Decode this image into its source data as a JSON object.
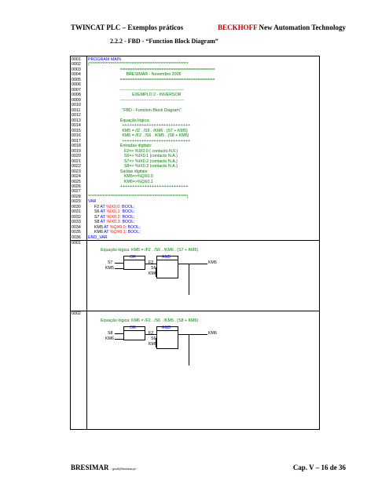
{
  "header": {
    "left": "TWINCAT PLC – Exemplos práticos",
    "brand": "BECKHOFF",
    "right_rest": "New Automation Technology"
  },
  "section": "2.2.2 - FBD - “Function Block Diagram”",
  "code_lines": [
    {
      "n": "0001",
      "t": "PROGRAM MAIN",
      "c": "blue",
      "i": 0
    },
    {
      "n": "0002",
      "t": "(*************************************************************",
      "c": "green",
      "i": 0
    },
    {
      "n": "0003",
      "t": "=======================================",
      "c": "green",
      "i": 16
    },
    {
      "n": "0004",
      "t": "BRESIMAR - Novembro 2005",
      "c": "green",
      "i": 19
    },
    {
      "n": "0005",
      "t": "=======================================",
      "c": "green",
      "i": 16
    },
    {
      "n": "0006",
      "t": "",
      "c": "green",
      "i": 0
    },
    {
      "n": "0007",
      "t": "----------------------------------------------",
      "c": "green",
      "i": 16
    },
    {
      "n": "0008",
      "t": "EXEMPLO 2 - INVERSOR",
      "c": "green",
      "i": 22
    },
    {
      "n": "0009",
      "t": "----------------------------------------------",
      "c": "green",
      "i": 16
    },
    {
      "n": "0010",
      "t": "",
      "c": "green",
      "i": 0
    },
    {
      "n": "0011",
      "t": "\"FBD - Function Block Diagram\"",
      "c": "green",
      "i": 17
    },
    {
      "n": "0012",
      "t": "",
      "c": "green",
      "i": 0
    },
    {
      "n": "0013",
      "t": "Equação lógica:",
      "c": "green",
      "i": 16
    },
    {
      "n": "0014",
      "t": "++++++++++++++++++++++++++++",
      "c": "green",
      "i": 17
    },
    {
      "n": "0015",
      "t": "KM5 = /I2 . /S6 . /KM6 . (S7 + KM5)",
      "c": "green",
      "i": 17
    },
    {
      "n": "0016",
      "t": "KM6 = /F2 . /S6 . /KM5 . (S8 + KM6)",
      "c": "green",
      "i": 17
    },
    {
      "n": "0017",
      "t": "++++++++++++++++++++++++++++",
      "c": "green",
      "i": 17
    },
    {
      "n": "0018",
      "t": "Entradas digitais:",
      "c": "green",
      "i": 16
    },
    {
      "n": "0019",
      "t": "F2=> %IX0.0 ( contacto N.F.)",
      "c": "green",
      "i": 18
    },
    {
      "n": "0020",
      "t": "S6=> %IX0.1 (contacto N.A.)",
      "c": "green",
      "i": 18
    },
    {
      "n": "0021",
      "t": "S7=> %IX0.2 (contacto N.A.)",
      "c": "green",
      "i": 18
    },
    {
      "n": "0022",
      "t": "S8=> %IX0.3 (contacto N.A.)",
      "c": "green",
      "i": 18
    },
    {
      "n": "0023",
      "t": "Saídas digitais:",
      "c": "green",
      "i": 16
    },
    {
      "n": "0024",
      "t": "KM5=>%QX0.0",
      "c": "green",
      "i": 18
    },
    {
      "n": "0025",
      "t": "KM6=>%QX0.1",
      "c": "green",
      "i": 18
    },
    {
      "n": "0026",
      "t": "++++++++++++++++++++++++++++",
      "c": "green",
      "i": 16
    },
    {
      "n": "0027",
      "t": "",
      "c": "green",
      "i": 0
    },
    {
      "n": "0028",
      "t": "*************************************************************)",
      "c": "green",
      "i": 0
    },
    {
      "n": "0029",
      "t": "VAR",
      "c": "blue",
      "i": 0
    }
  ],
  "var_lines": [
    {
      "n": "0030",
      "name": "F2",
      "addr": "%IX0.0",
      "type": "BOOL;"
    },
    {
      "n": "0031",
      "name": "S6",
      "addr": "%IX0.1",
      "type": "BOOL;"
    },
    {
      "n": "0032",
      "name": "S7",
      "addr": "%IX0.2",
      "type": "BOOL;"
    },
    {
      "n": "0033",
      "name": "S8",
      "addr": "%IX0.3",
      "type": "BOOL;"
    },
    {
      "n": "0034",
      "name": "KM5",
      "addr": "%QX0.0",
      "type": "BOOL;"
    },
    {
      "n": "0035",
      "name": "KM6",
      "addr": "%QX0.1",
      "type": "BOOL;"
    }
  ],
  "var_at": "AT",
  "end_var": {
    "n": "0036",
    "t": "END_VAR"
  },
  "networks": [
    {
      "n": "0001",
      "comment": "Equação lógica: KM5 = /F2 . /S6 . /KM6 . (S7 + KM5)",
      "or_label": "OR",
      "and_label": "AND",
      "in1": "S7",
      "in2": "KM5",
      "a1": "F2",
      "a2": "S6",
      "a3": "KM6",
      "out": "KM5"
    },
    {
      "n": "0002",
      "comment": "Equação lógica: KM6 = /F2 . /S6 . /KM5 . (S8 + KM6)",
      "or_label": "OR",
      "and_label": "AND",
      "in1": "S8",
      "in2": "KM6",
      "a1": "F2",
      "a2": "S6",
      "a3": "KM5",
      "out": "KM6"
    }
  ],
  "footer": {
    "left": "BRESIMAR",
    "left_small": "- geral@bresimar.pt -",
    "right": "Cap. V – 16 de 36"
  }
}
